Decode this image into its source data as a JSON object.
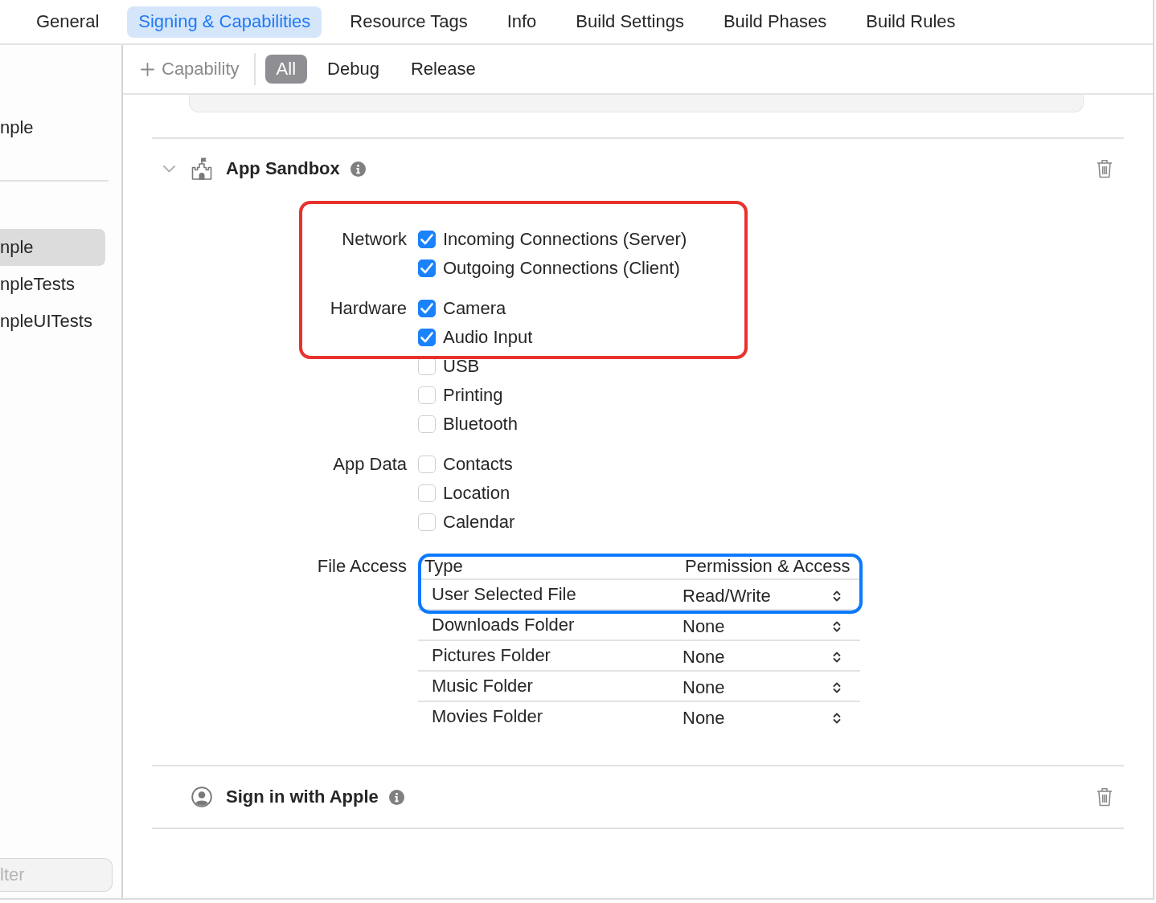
{
  "tabs": [
    {
      "label": "General",
      "selected": false
    },
    {
      "label": "Signing & Capabilities",
      "selected": true
    },
    {
      "label": "Resource Tags",
      "selected": false
    },
    {
      "label": "Info",
      "selected": false
    },
    {
      "label": "Build Settings",
      "selected": false
    },
    {
      "label": "Build Phases",
      "selected": false
    },
    {
      "label": "Build Rules",
      "selected": false
    }
  ],
  "sidebar": {
    "project": [
      {
        "label": "nple",
        "selected": false
      }
    ],
    "targets": [
      {
        "label": "nple",
        "selected": true
      },
      {
        "label": "npleTests",
        "selected": false
      },
      {
        "label": "npleUITests",
        "selected": false
      }
    ],
    "filter": {
      "placeholder": "lter"
    }
  },
  "toolbar": {
    "add_label": "Capability",
    "configurations": [
      {
        "label": "All",
        "selected": true
      },
      {
        "label": "Debug",
        "selected": false
      },
      {
        "label": "Release",
        "selected": false
      }
    ]
  },
  "capabilities": [
    {
      "kind": "sandbox",
      "title": "App Sandbox",
      "expanded": true,
      "groups": [
        {
          "label": "Network",
          "options": [
            {
              "label": "Incoming Connections (Server)",
              "checked": true
            },
            {
              "label": "Outgoing Connections (Client)",
              "checked": true
            }
          ]
        },
        {
          "label": "Hardware",
          "options": [
            {
              "label": "Camera",
              "checked": true
            },
            {
              "label": "Audio Input",
              "checked": true
            },
            {
              "label": "USB",
              "checked": false
            },
            {
              "label": "Printing",
              "checked": false
            },
            {
              "label": "Bluetooth",
              "checked": false
            }
          ]
        },
        {
          "label": "App Data",
          "options": [
            {
              "label": "Contacts",
              "checked": false
            },
            {
              "label": "Location",
              "checked": false
            },
            {
              "label": "Calendar",
              "checked": false
            }
          ]
        }
      ],
      "file_access": {
        "label": "File Access",
        "columns": [
          "Type",
          "Permission & Access"
        ],
        "rows": [
          {
            "type": "User Selected File",
            "permission": "Read/Write"
          },
          {
            "type": "Downloads Folder",
            "permission": "None"
          },
          {
            "type": "Pictures Folder",
            "permission": "None"
          },
          {
            "type": "Music Folder",
            "permission": "None"
          },
          {
            "type": "Movies Folder",
            "permission": "None"
          }
        ]
      },
      "annotations": [
        {
          "kind": "entitlements",
          "color": "#e8322d"
        },
        {
          "kind": "file_access",
          "color": "#0a7aff"
        }
      ]
    },
    {
      "kind": "sign_in",
      "title": "Sign in with Apple"
    }
  ]
}
